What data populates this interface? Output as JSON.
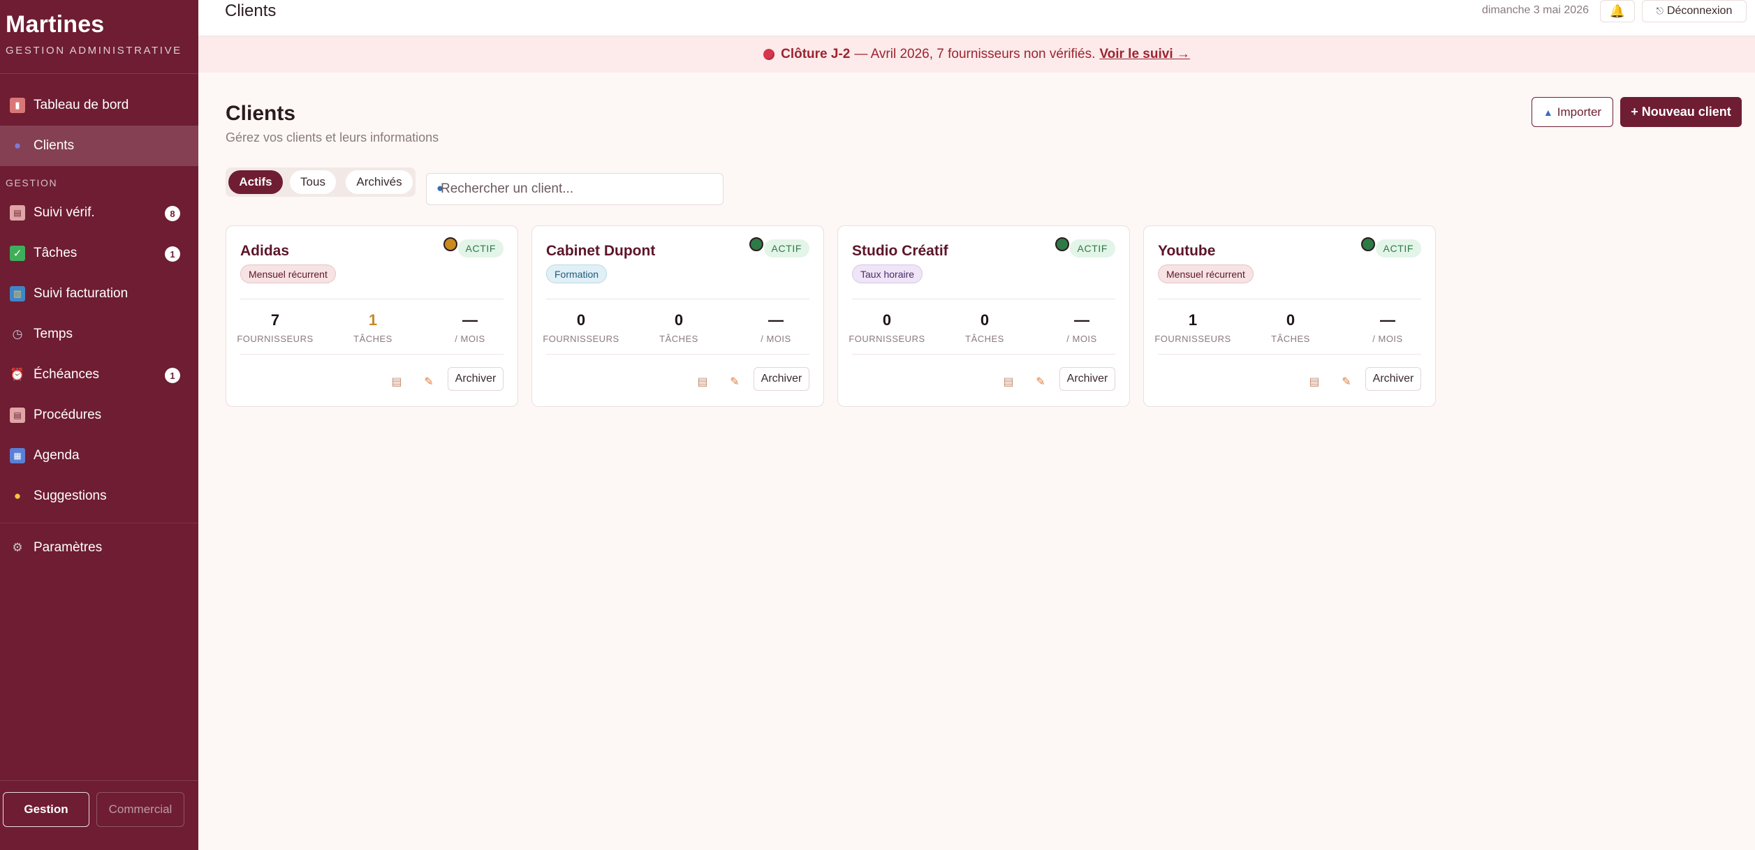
{
  "app": {
    "brand_title": "Martines",
    "brand_subtitle": "GESTION ADMINISTRATIVE"
  },
  "sidebar": {
    "items_top": [
      {
        "label": "Tableau de bord",
        "icon": "bar-chart-icon"
      },
      {
        "label": "Clients",
        "icon": "users-icon",
        "active": true
      }
    ],
    "section_label": "GESTION",
    "items_gestion": [
      {
        "label": "Suivi vérif.",
        "icon": "clipboard-icon",
        "badge": "8"
      },
      {
        "label": "Tâches",
        "icon": "checkbox-icon",
        "badge": "1"
      },
      {
        "label": "Suivi facturation",
        "icon": "books-icon"
      },
      {
        "label": "Temps",
        "icon": "stopwatch-icon"
      },
      {
        "label": "Échéances",
        "icon": "alarm-clock-icon",
        "badge": "1"
      },
      {
        "label": "Procédures",
        "icon": "clipboard-icon"
      },
      {
        "label": "Agenda",
        "icon": "calendar-icon"
      },
      {
        "label": "Suggestions",
        "icon": "lightbulb-icon"
      }
    ],
    "settings_label": "Paramètres",
    "mode_gestion": "Gestion",
    "mode_commercial": "Commercial"
  },
  "topbar": {
    "title": "Clients",
    "date": "dimanche 3 mai 2026",
    "logout_label": "Déconnexion"
  },
  "alert": {
    "strong": "Clôture J-2",
    "text": "— Avril 2026, 7 fournisseurs non vérifiés.",
    "link": "Voir le suivi →"
  },
  "page": {
    "title": "Clients",
    "subtitle": "Gérez vos clients et leurs informations",
    "import_label": "Importer",
    "new_label": "+ Nouveau client"
  },
  "filters": {
    "active": "Actifs",
    "all": "Tous",
    "archived": "Archivés"
  },
  "search": {
    "placeholder": "Rechercher un client..."
  },
  "colors": {
    "brand": "#6e1d33",
    "dot_orange": "#c98a1e",
    "dot_green": "#2d7a46"
  },
  "cards": [
    {
      "name": "Adidas",
      "status": "ACTIF",
      "tag": "Mensuel récurrent",
      "dot": "#c98a1e",
      "fournisseurs": "7",
      "taches": "1",
      "mois": "—",
      "lbl_fournisseurs": "FOURNISSEURS",
      "lbl_taches": "TÂCHES",
      "lbl_mois": "/ MOIS",
      "archive": "Archiver"
    },
    {
      "name": "Cabinet Dupont",
      "status": "ACTIF",
      "tag": "Formation",
      "dot": "#2d7a46",
      "fournisseurs": "0",
      "taches": "0",
      "mois": "—",
      "lbl_fournisseurs": "FOURNISSEURS",
      "lbl_taches": "TÂCHES",
      "lbl_mois": "/ MOIS",
      "archive": "Archiver"
    },
    {
      "name": "Studio Créatif",
      "status": "ACTIF",
      "tag": "Taux horaire",
      "dot": "#2d7a46",
      "fournisseurs": "0",
      "taches": "0",
      "mois": "—",
      "lbl_fournisseurs": "FOURNISSEURS",
      "lbl_taches": "TÂCHES",
      "lbl_mois": "/ MOIS",
      "archive": "Archiver"
    },
    {
      "name": "Youtube",
      "status": "ACTIF",
      "tag": "Mensuel récurrent",
      "dot": "#2d7a46",
      "fournisseurs": "1",
      "taches": "0",
      "mois": "—",
      "lbl_fournisseurs": "FOURNISSEURS",
      "lbl_taches": "TÂCHES",
      "lbl_mois": "/ MOIS",
      "archive": "Archiver"
    }
  ]
}
